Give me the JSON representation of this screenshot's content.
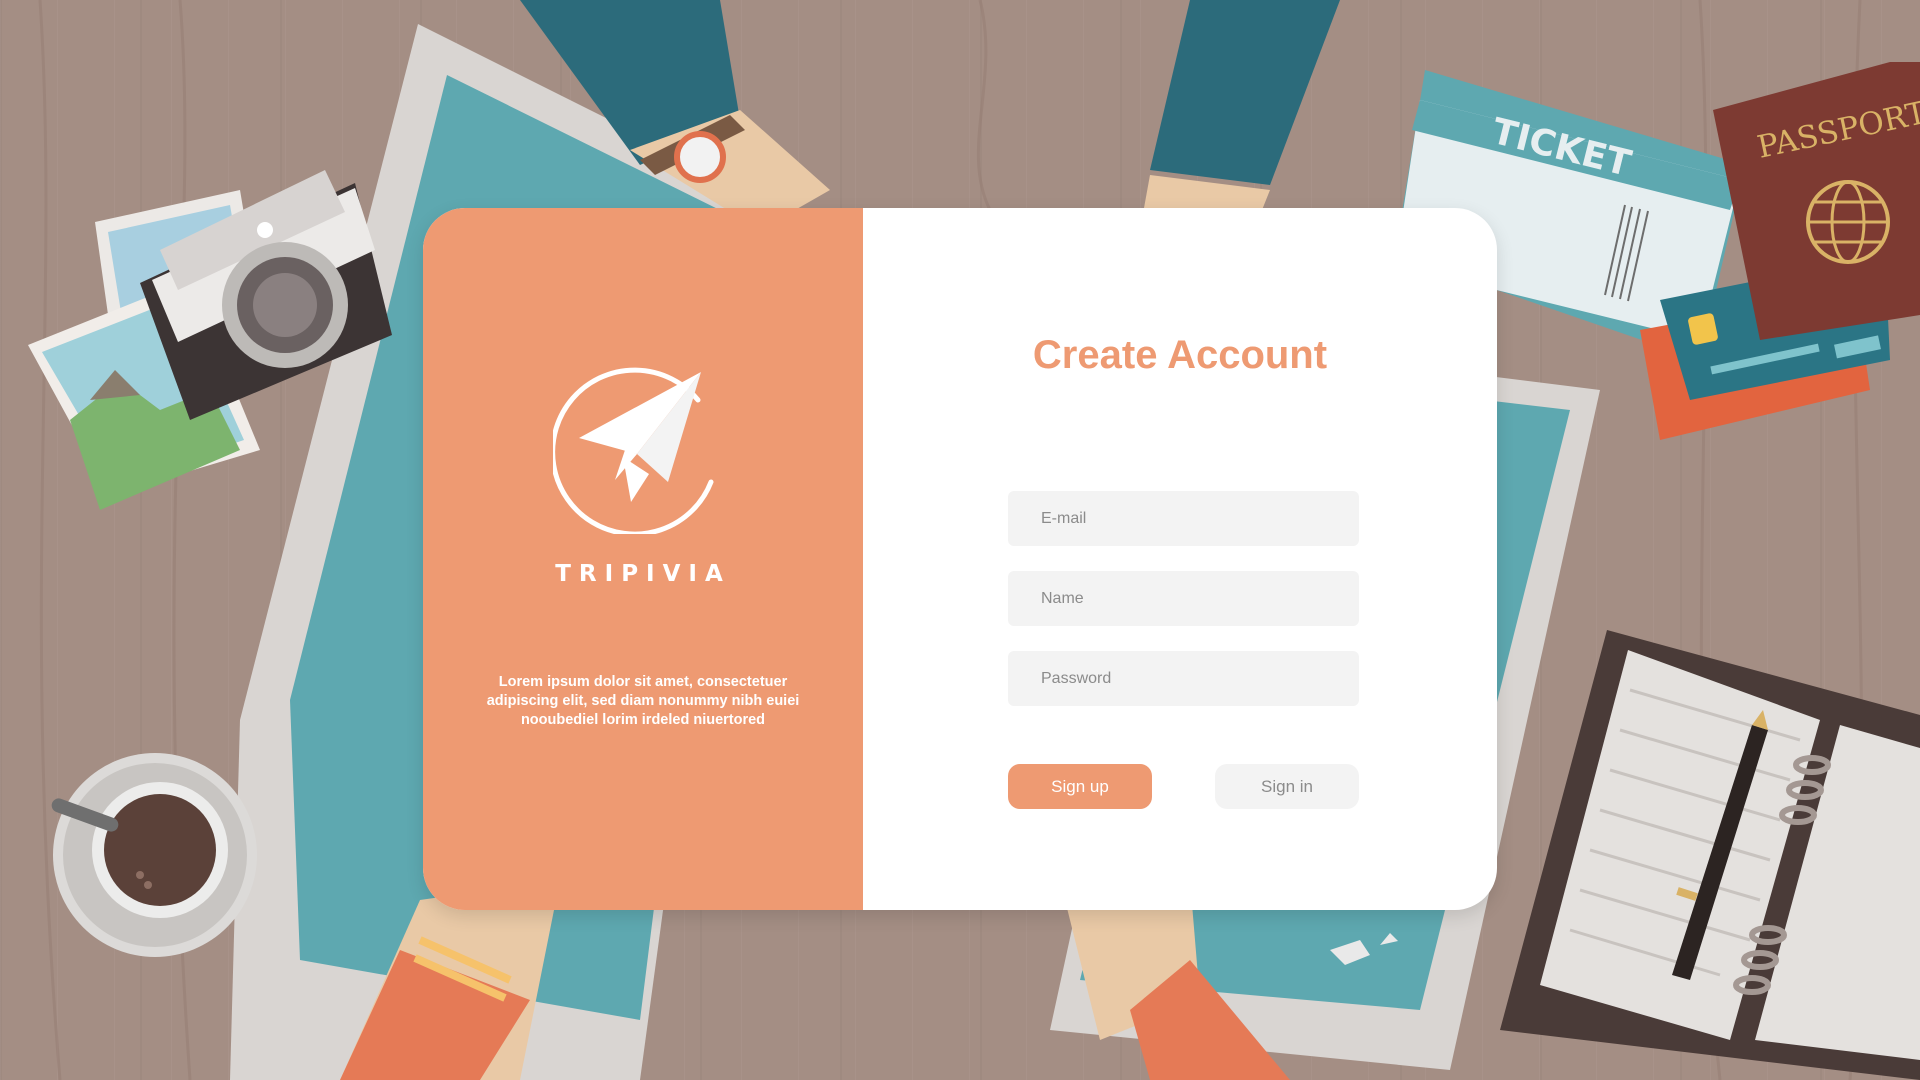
{
  "brand": {
    "name": "TRIPIVIA",
    "description": "Lorem ipsum dolor sit amet, consectetuer adipiscing elit, sed diam nonummy nibh euiei nooubediel lorim irdeled niuertored",
    "logo_icon": "paper-plane-icon"
  },
  "form": {
    "title": "Create Account",
    "email_placeholder": "E-mail",
    "name_placeholder": "Name",
    "password_placeholder": "Password",
    "email_value": "",
    "name_value": "",
    "password_value": ""
  },
  "buttons": {
    "signup_label": "Sign up",
    "signin_label": "Sign in"
  },
  "background": {
    "ticket_text": "TICKET",
    "passport_text": "PASSPORT"
  },
  "colors": {
    "accent": "#ee9a72",
    "field_bg": "#f3f3f3",
    "wood": "#a48e84",
    "map_teal": "#5ea8b0"
  }
}
